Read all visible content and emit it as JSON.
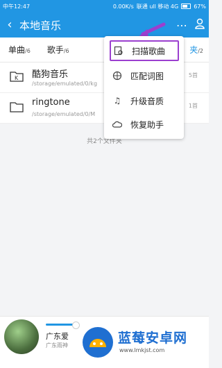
{
  "statusbar": {
    "carrier": "中午12:47",
    "speed": "0.00K/s",
    "network": "联通 ull 移动 4G",
    "battery": "67%"
  },
  "appbar": {
    "title": "本地音乐",
    "more_icon": "more-dots-icon",
    "user_icon": "user-icon"
  },
  "tabs": [
    {
      "label": "单曲",
      "count": "/6"
    },
    {
      "label": "歌手",
      "count": "/6"
    },
    {
      "label": "夹",
      "count": "/2"
    }
  ],
  "folders": [
    {
      "name": "酷狗音乐",
      "path": "/storage/emulated/0/kg",
      "count": "5首"
    },
    {
      "name": "ringtone",
      "path": "/storage/emulated/0/M",
      "count": "1首"
    }
  ],
  "summary": "共2个文件夹",
  "menu": {
    "items": [
      {
        "label": "扫描歌曲",
        "icon": "scan-icon"
      },
      {
        "label": "匹配词图",
        "icon": "match-icon"
      },
      {
        "label": "升级音质",
        "icon": "music-note-icon"
      },
      {
        "label": "恢复助手",
        "icon": "cloud-icon"
      }
    ]
  },
  "player": {
    "song": "广东爱",
    "artist": "广东雨神",
    "progress": 0.35
  },
  "watermark": {
    "title": "蓝莓安卓网",
    "url": "www.lmkjst.com"
  },
  "colors": {
    "accent": "#2196e3",
    "highlight": "#9b3fcf"
  }
}
